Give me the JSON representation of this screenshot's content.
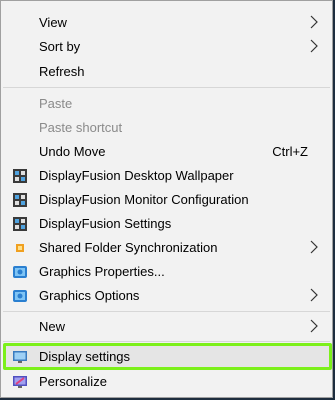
{
  "menu": {
    "items": [
      {
        "label": "View",
        "submenu": true
      },
      {
        "label": "Sort by",
        "submenu": true
      },
      {
        "label": "Refresh"
      },
      {
        "label": "Paste",
        "disabled": true
      },
      {
        "label": "Paste shortcut",
        "disabled": true
      },
      {
        "label": "Undo Move",
        "shortcut": "Ctrl+Z"
      },
      {
        "label": "DisplayFusion Desktop Wallpaper",
        "icon": "displayfusion-icon"
      },
      {
        "label": "DisplayFusion Monitor Configuration",
        "icon": "displayfusion-icon"
      },
      {
        "label": "DisplayFusion Settings",
        "icon": "displayfusion-icon"
      },
      {
        "label": "Shared Folder Synchronization",
        "icon": "sync-icon",
        "submenu": true
      },
      {
        "label": "Graphics Properties...",
        "icon": "graphics-icon"
      },
      {
        "label": "Graphics Options",
        "icon": "graphics-icon",
        "submenu": true
      },
      {
        "label": "New",
        "submenu": true
      },
      {
        "label": "Display settings",
        "icon": "display-icon",
        "highlighted": true
      },
      {
        "label": "Personalize",
        "icon": "personalize-icon"
      }
    ]
  },
  "colors": {
    "highlight_border": "#7cf01a",
    "menu_background": "#f2f2f2",
    "disabled_text": "#8a8a8a"
  }
}
